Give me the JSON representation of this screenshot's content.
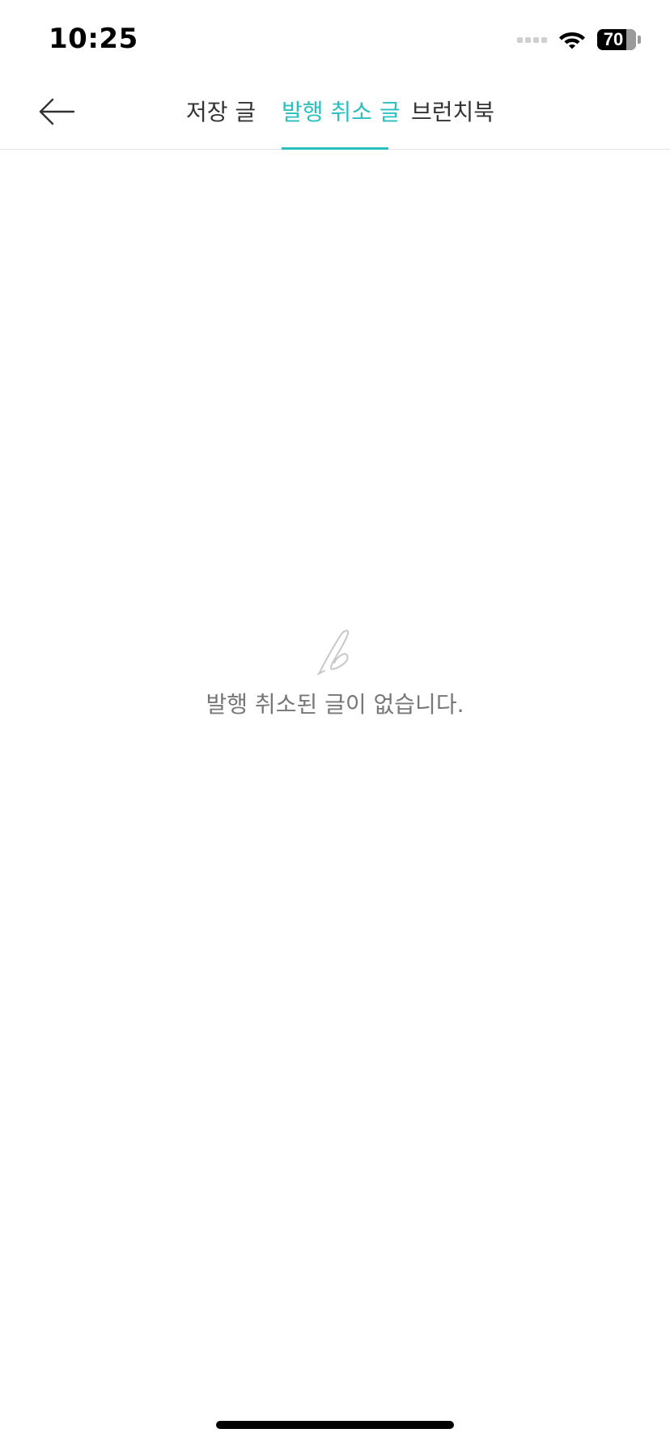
{
  "status_bar": {
    "time": "10:25",
    "battery_percent": "70",
    "battery_level": 0.7,
    "icons": [
      "signal-icon",
      "wifi-icon",
      "battery-icon"
    ]
  },
  "nav": {
    "back_icon": "arrow-left-icon",
    "tabs": [
      {
        "label": "저장 글",
        "active": false
      },
      {
        "label": "발행 취소 글",
        "active": true
      },
      {
        "label": "브런치북",
        "active": false
      }
    ]
  },
  "empty_state": {
    "icon": "brunch-logo-icon",
    "message": "발행 취소된 글이 없습니다."
  },
  "colors": {
    "accent": "#2bbfbf",
    "text": "#333333",
    "muted_text": "#777777",
    "divider": "#e2e2e2"
  }
}
